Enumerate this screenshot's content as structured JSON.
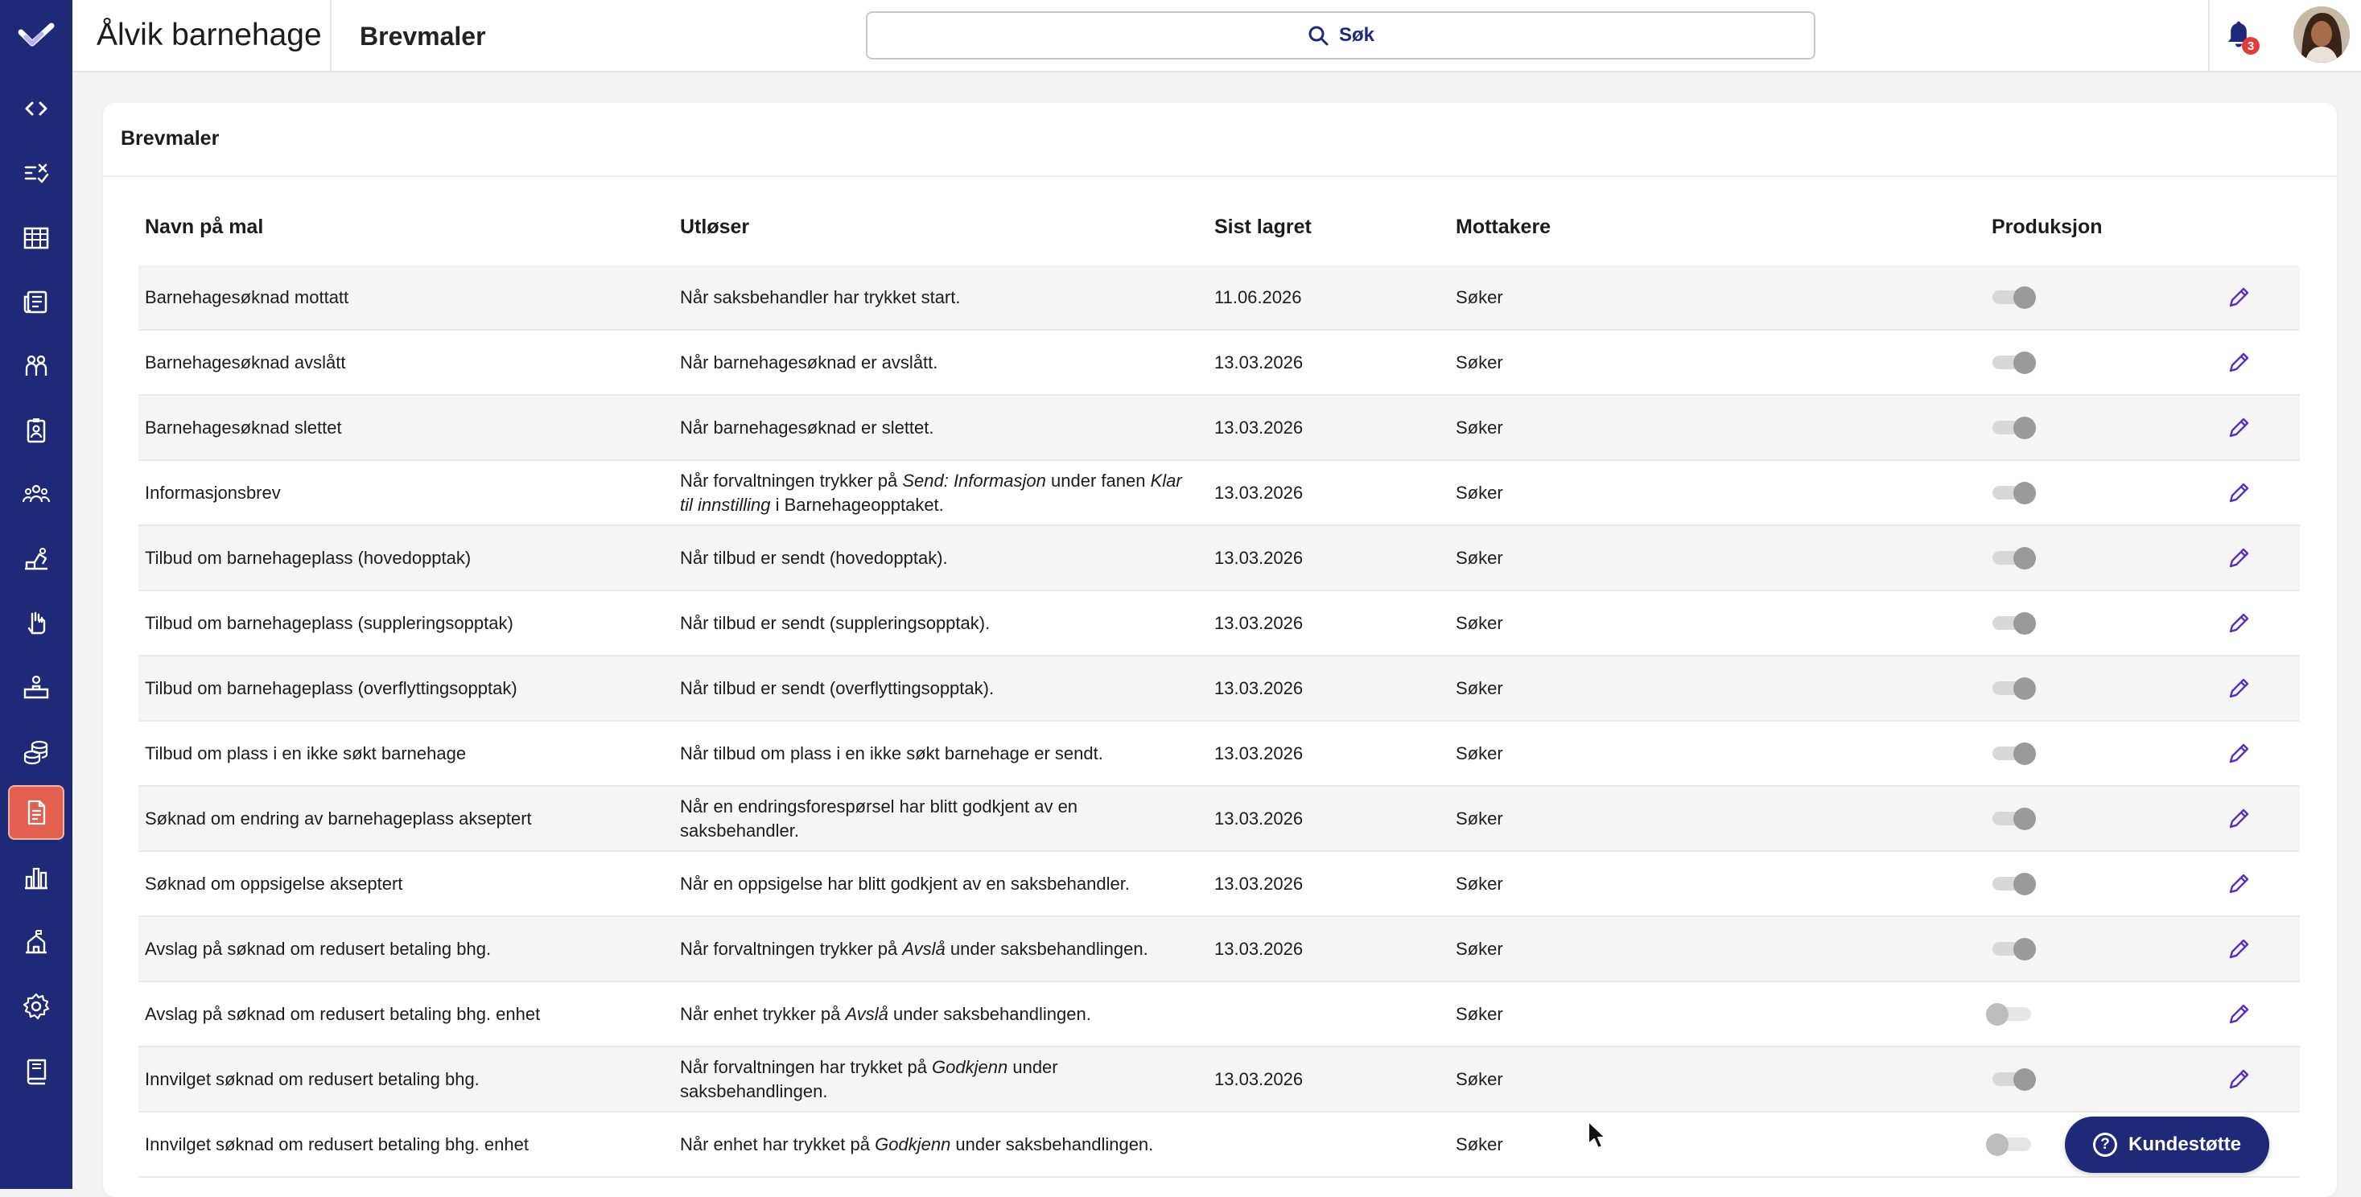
{
  "topbar": {
    "org_name": "Ålvik barnehage",
    "page_title": "Brevmaler",
    "search_label": "Søk",
    "notification_count": "3"
  },
  "sidebar": {
    "items": [
      {
        "icon": "code-brackets-icon"
      },
      {
        "icon": "checklist-icon"
      },
      {
        "icon": "calendar-grid-icon"
      },
      {
        "icon": "newspaper-icon"
      },
      {
        "icon": "children-group-icon"
      },
      {
        "icon": "id-badge-icon"
      },
      {
        "icon": "people-group-icon"
      },
      {
        "icon": "blocks-icon"
      },
      {
        "icon": "raised-hand-icon"
      },
      {
        "icon": "desk-icon"
      },
      {
        "icon": "coins-icon"
      },
      {
        "icon": "document-icon",
        "active": true
      },
      {
        "icon": "bar-chart-icon"
      },
      {
        "icon": "school-building-icon"
      },
      {
        "icon": "gear-icon"
      },
      {
        "icon": "book-icon"
      }
    ]
  },
  "card": {
    "title": "Brevmaler",
    "columns": {
      "name": "Navn på mal",
      "trigger": "Utløser",
      "saved": "Sist lagret",
      "recipients": "Mottakere",
      "production": "Produksjon"
    }
  },
  "rows": [
    {
      "name": "Barnehagesøknad mottatt",
      "trigger": "Når saksbehandler har trykket start.",
      "saved": "11.06.2026",
      "recipients": "Søker",
      "production": true
    },
    {
      "name": "Barnehagesøknad avslått",
      "trigger": "Når barnehagesøknad er avslått.",
      "saved": "13.03.2026",
      "recipients": "Søker",
      "production": true
    },
    {
      "name": "Barnehagesøknad slettet",
      "trigger": "Når barnehagesøknad er slettet.",
      "saved": "13.03.2026",
      "recipients": "Søker",
      "production": true
    },
    {
      "name": "Informasjonsbrev",
      "trigger": "Når forvaltningen trykker på Send: Informasjon under fanen Klar til innstilling i Barnehageopptaket.",
      "saved": "13.03.2026",
      "recipients": "Søker",
      "production": true
    },
    {
      "name": "Tilbud om barnehageplass (hovedopptak)",
      "trigger": "Når tilbud er sendt (hovedopptak).",
      "saved": "13.03.2026",
      "recipients": "Søker",
      "production": true
    },
    {
      "name": "Tilbud om barnehageplass (suppleringsopptak)",
      "trigger": "Når tilbud er sendt (suppleringsopptak).",
      "saved": "13.03.2026",
      "recipients": "Søker",
      "production": true
    },
    {
      "name": "Tilbud om barnehageplass (overflyttingsopptak)",
      "trigger": "Når tilbud er sendt (overflyttingsopptak).",
      "saved": "13.03.2026",
      "recipients": "Søker",
      "production": true
    },
    {
      "name": "Tilbud om plass i en ikke søkt barnehage",
      "trigger": "Når tilbud om plass i en ikke søkt barnehage er sendt.",
      "saved": "13.03.2026",
      "recipients": "Søker",
      "production": true
    },
    {
      "name": "Søknad om endring av barnehageplass akseptert",
      "trigger": "Når en endringsforespørsel har blitt godkjent av en saksbehandler.",
      "saved": "13.03.2026",
      "recipients": "Søker",
      "production": true
    },
    {
      "name": "Søknad om oppsigelse akseptert",
      "trigger": "Når en oppsigelse har blitt godkjent av en saksbehandler.",
      "saved": "13.03.2026",
      "recipients": "Søker",
      "production": true
    },
    {
      "name": "Avslag på søknad om redusert betaling bhg.",
      "trigger": "Når forvaltningen trykker på Avslå under saksbehandlingen.",
      "saved": "13.03.2026",
      "recipients": "Søker",
      "production": true
    },
    {
      "name": "Avslag på søknad om redusert betaling bhg. enhet",
      "trigger": "Når enhet trykker på Avslå under saksbehandlingen.",
      "saved": "",
      "recipients": "Søker",
      "production": false
    },
    {
      "name": "Innvilget søknad om redusert betaling bhg.",
      "trigger": "Når forvaltningen har trykket på Godkjenn under saksbehandlingen.",
      "saved": "13.03.2026",
      "recipients": "Søker",
      "production": true
    },
    {
      "name": "Innvilget søknad om redusert betaling bhg. enhet",
      "trigger": "Når enhet har trykket på Godkjenn under saksbehandlingen.",
      "saved": "",
      "recipients": "Søker",
      "production": false
    }
  ],
  "support_button": {
    "label": "Kundestøtte",
    "icon": "question-icon"
  },
  "colors": {
    "brand_navy": "#1e2a78",
    "active_nav": "#e35f4f",
    "edit_icon": "#5b2fb8",
    "badge": "#e23b3b"
  }
}
